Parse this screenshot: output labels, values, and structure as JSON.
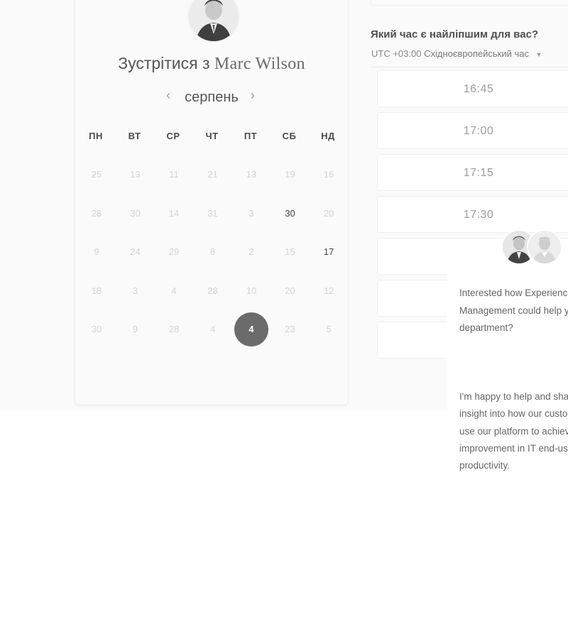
{
  "booking": {
    "title_prefix": "Зустрітися з",
    "host_name": "Marc Wilson",
    "host_avatar_icon": "person-avatar"
  },
  "calendar": {
    "month": "серпень",
    "prev_icon": "chevron-left-icon",
    "next_icon": "chevron-right-icon",
    "weekdays": [
      "ПН",
      "ВТ",
      "СР",
      "ЧТ",
      "ПТ",
      "СБ",
      "НД"
    ],
    "weeks": [
      [
        "25",
        "13",
        "11",
        "21",
        "13",
        "19",
        "16"
      ],
      [
        "28",
        "30",
        "14",
        "31",
        "3",
        "30",
        "20"
      ],
      [
        "9",
        "24",
        "29",
        "8",
        "2",
        "15",
        "17"
      ],
      [
        "18",
        "3",
        "4",
        "28",
        "10",
        "20",
        "12"
      ],
      [
        "30",
        "9",
        "28",
        "4",
        "4",
        "23",
        "5"
      ]
    ],
    "available_days": [
      "30",
      "17"
    ],
    "selected_day": "4",
    "selected_color": "#6b6b6b"
  },
  "times": {
    "heading": "Який час є найліпшим для вас?",
    "timezone_prefix": "UTC +03:00",
    "timezone_name": "Східноєвропейський час",
    "slots": [
      "16:45",
      "17:00",
      "17:15",
      "17:30"
    ]
  },
  "chat": {
    "paragraph1": "Interested how Experienc\nManagement could help y\ndepartment?",
    "paragraph2": "I'm happy to help and sha\ninsight into how our custo\nuse our platform to achiev\nimprovement in IT end-us\nproductivity."
  }
}
